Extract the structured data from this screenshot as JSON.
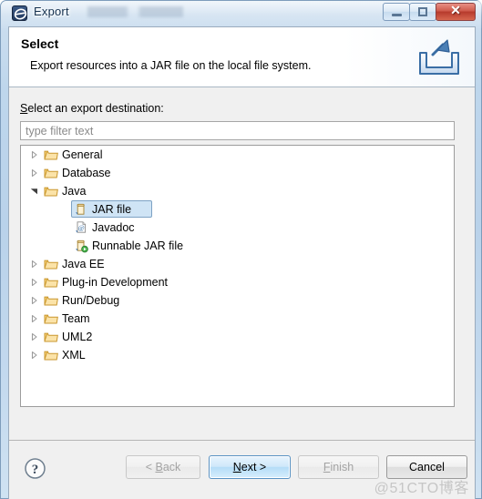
{
  "window": {
    "title": "Export",
    "app_icon": "eclipse-icon",
    "controls": {
      "minimize_label": "",
      "maximize_label": "",
      "close_label": "✕"
    }
  },
  "header": {
    "title": "Select",
    "description": "Export resources into a JAR file on the local file system.",
    "icon": "export-wizard-icon"
  },
  "content": {
    "destination_label_mnemonic": "S",
    "destination_label_rest": "elect an export destination:",
    "filter": {
      "placeholder": "type filter text",
      "value": ""
    },
    "tree": [
      {
        "label": "General",
        "depth": 0,
        "expanded": false,
        "icon": "folder-icon",
        "selected": false
      },
      {
        "label": "Database",
        "depth": 0,
        "expanded": false,
        "icon": "folder-icon",
        "selected": false
      },
      {
        "label": "Java",
        "depth": 0,
        "expanded": true,
        "icon": "folder-icon",
        "selected": false
      },
      {
        "label": "JAR file",
        "depth": 1,
        "expanded": null,
        "icon": "jar-file-icon",
        "selected": true
      },
      {
        "label": "Javadoc",
        "depth": 1,
        "expanded": null,
        "icon": "javadoc-icon",
        "selected": false
      },
      {
        "label": "Runnable JAR file",
        "depth": 1,
        "expanded": null,
        "icon": "runnable-jar-icon",
        "selected": false
      },
      {
        "label": "Java EE",
        "depth": 0,
        "expanded": false,
        "icon": "folder-icon",
        "selected": false
      },
      {
        "label": "Plug-in Development",
        "depth": 0,
        "expanded": false,
        "icon": "folder-icon",
        "selected": false
      },
      {
        "label": "Run/Debug",
        "depth": 0,
        "expanded": false,
        "icon": "folder-icon",
        "selected": false
      },
      {
        "label": "Team",
        "depth": 0,
        "expanded": false,
        "icon": "folder-icon",
        "selected": false
      },
      {
        "label": "UML2",
        "depth": 0,
        "expanded": false,
        "icon": "folder-icon",
        "selected": false
      },
      {
        "label": "XML",
        "depth": 0,
        "expanded": false,
        "icon": "folder-icon",
        "selected": false
      }
    ]
  },
  "buttons": {
    "help_icon": "help-icon",
    "back": {
      "prefix": "< ",
      "mnemonic": "B",
      "rest": "ack",
      "state": "disabled"
    },
    "next": {
      "prefix": "",
      "mnemonic": "N",
      "rest": "ext >",
      "state": "default"
    },
    "finish": {
      "prefix": "",
      "mnemonic": "F",
      "rest": "inish",
      "state": "disabled"
    },
    "cancel": {
      "prefix": "",
      "mnemonic": "",
      "rest": "Cancel",
      "state": "normal"
    }
  },
  "watermark": "@51CTO博客",
  "colors": {
    "accent": "#3c5a86",
    "selection_fill": "#cfe4f5",
    "selection_border": "#7da2c4",
    "close_button": "#b63a2c",
    "dialog_bg": "#f0f0f0",
    "folder_icon": "#f0c060"
  }
}
